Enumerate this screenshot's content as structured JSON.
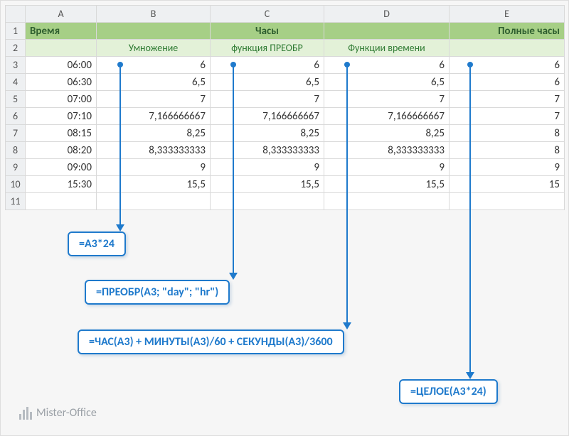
{
  "columns": [
    "A",
    "B",
    "C",
    "D",
    "E"
  ],
  "rowNumbers": [
    "1",
    "2",
    "3",
    "4",
    "5",
    "6",
    "7",
    "8",
    "9",
    "10",
    "11"
  ],
  "header1": {
    "A": "Время",
    "C_center": "Часы",
    "E_right": "Полные часы"
  },
  "header2": {
    "B": "Умножение",
    "C": "функция ПРЕОБР",
    "D": "Функции времени"
  },
  "rows": [
    {
      "A": "06:00",
      "B": "6",
      "C": "6",
      "D": "6",
      "E": "6"
    },
    {
      "A": "06:30",
      "B": "6,5",
      "C": "6,5",
      "D": "6,5",
      "E": "6"
    },
    {
      "A": "07:00",
      "B": "7",
      "C": "7",
      "D": "7",
      "E": "7"
    },
    {
      "A": "07:10",
      "B": "7,166666667",
      "C": "7,166666667",
      "D": "7,166666667",
      "E": "7"
    },
    {
      "A": "08:15",
      "B": "8,25",
      "C": "8,25",
      "D": "8,25",
      "E": "8"
    },
    {
      "A": "08:20",
      "B": "8,333333333",
      "C": "8,333333333",
      "D": "8,333333333",
      "E": "8"
    },
    {
      "A": "09:00",
      "B": "9",
      "C": "9",
      "D": "9",
      "E": "9"
    },
    {
      "A": "15:30",
      "B": "15,5",
      "C": "15,5",
      "D": "15,5",
      "E": "15"
    }
  ],
  "formulas": {
    "B": "=A3*24",
    "C": "=ПРЕОБР(A3; \"day\"; \"hr\")",
    "D": "=ЧАС(A3) + МИНУТЫ(A3)/60 + СЕКУНДЫ(A3)/3600",
    "E": "=ЦЕЛОЕ(A3*24)"
  },
  "logo": "Mister-Office"
}
